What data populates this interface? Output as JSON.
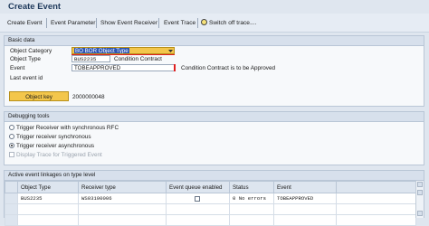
{
  "title": "Create Event",
  "toolbar": {
    "create_event": "Create Event",
    "event_parameter": "Event Parameter",
    "show_event_receiver": "Show Event Receiver",
    "event_trace": "Event Trace",
    "switch_off_trace": "Switch off trace...."
  },
  "basic_data": {
    "header": "Basic data",
    "object_category_label": "Object Category",
    "object_category_value": "BO BOR Object Type",
    "object_type_label": "Object Type",
    "object_type_value": "BUS2235",
    "object_type_desc": "Condition Contract",
    "event_label": "Event",
    "event_value": "TOBEAPPROVED",
    "event_desc": "Condition Contract is to be Approved",
    "last_event_id_label": "Last event id",
    "object_key_button": "Object key",
    "object_key_value": "2000000048"
  },
  "debugging": {
    "header": "Debugging tools",
    "options": [
      {
        "label": "Trigger Receiver with synchronous RFC",
        "selected": false
      },
      {
        "label": "Trigger receiver synchronous",
        "selected": false
      },
      {
        "label": "Trigger receiver asynchronous",
        "selected": true
      }
    ],
    "display_trace_label": "Display Trace for Triggered Event"
  },
  "linkages": {
    "header": "Active event linkages on type level",
    "columns": [
      "Object Type",
      "Receiver type",
      "Event queue enabled",
      "Status",
      "Event"
    ],
    "rows": [
      {
        "object_type": "BUS2235",
        "receiver_type": "WS03100006",
        "queue_enabled": false,
        "status": "0 No errors",
        "event": "TOBEAPPROVED"
      }
    ]
  },
  "colors": {
    "accent_yellow": "#f3c64b",
    "highlight_blue": "#2d55b3",
    "required_red": "#e02020"
  }
}
